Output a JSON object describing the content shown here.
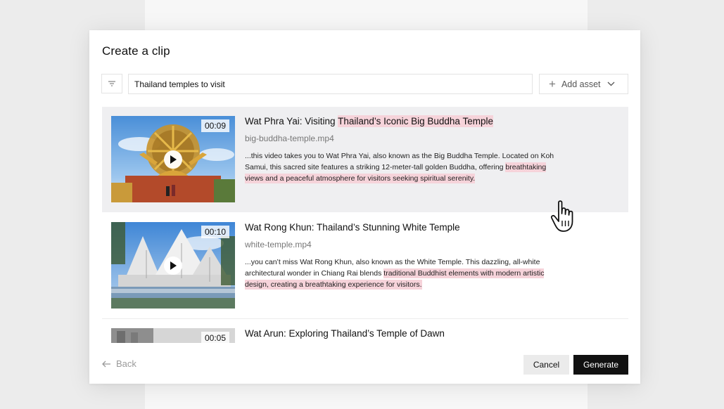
{
  "modal": {
    "title": "Create a clip"
  },
  "toolbar": {
    "filter_icon": "filter-icon",
    "search_value": "Thailand temples to visit",
    "add_asset_label": "Add asset"
  },
  "results": [
    {
      "title_plain": "Wat Phra Yai: Visiting ",
      "title_highlight": "Thailand’s Iconic Big Buddha Temple",
      "filename": "big-buddha-temple.mp4",
      "duration": "00:09",
      "desc_plain": "...this video takes you to Wat Phra Yai, also known as the Big Buddha Temple. Located on Koh Samui, this sacred site features a striking 12-meter-tall golden Buddha, offering ",
      "desc_highlight": "breathtaking views and a peaceful atmosphere for visitors seeking spiritual serenity."
    },
    {
      "title_plain": "Wat Rong Khun: Thailand’s Stunning White Temple",
      "filename": "white-temple.mp4",
      "duration": "00:10",
      "desc_plain": "...you can’t miss Wat Rong Khun, also known as the White Temple. This dazzling, all-white architectural wonder in Chiang Rai blends ",
      "desc_highlight": "traditional Buddhist elements with modern artistic design, creating a breathtaking experience for visitors."
    },
    {
      "title_plain": "Wat Arun: Exploring Thailand’s Temple of Dawn",
      "duration": "00:05"
    }
  ],
  "footer": {
    "back_label": "Back",
    "cancel_label": "Cancel",
    "generate_label": "Generate"
  },
  "colors": {
    "highlight": "#f6d3da",
    "primary_button": "#111111",
    "active_row": "#efeff1"
  }
}
